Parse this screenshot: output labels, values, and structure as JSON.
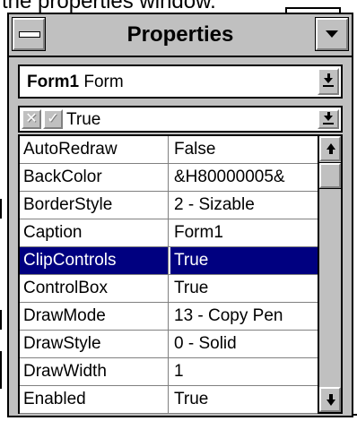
{
  "caption_text": "the properties window.",
  "window": {
    "title": "Properties",
    "sysmenu_icon": "system-menu-icon",
    "min_icon": "minimize-arrow-icon"
  },
  "object_combo": {
    "name": "Form1",
    "type": "Form"
  },
  "edit_bar": {
    "cancel_glyph": "✕",
    "accept_glyph": "✓",
    "value": "True"
  },
  "properties": [
    {
      "name": "AutoRedraw",
      "value": "False",
      "selected": false
    },
    {
      "name": "BackColor",
      "value": "&H80000005&",
      "selected": false
    },
    {
      "name": "BorderStyle",
      "value": "2 - Sizable",
      "selected": false
    },
    {
      "name": "Caption",
      "value": "Form1",
      "selected": false
    },
    {
      "name": "ClipControls",
      "value": "True",
      "selected": true
    },
    {
      "name": "ControlBox",
      "value": "True",
      "selected": false
    },
    {
      "name": "DrawMode",
      "value": "13 - Copy Pen",
      "selected": false
    },
    {
      "name": "DrawStyle",
      "value": "0 - Solid",
      "selected": false
    },
    {
      "name": "DrawWidth",
      "value": "1",
      "selected": false
    },
    {
      "name": "Enabled",
      "value": "True",
      "selected": false
    }
  ],
  "colors": {
    "selection": "#000080",
    "face": "#c0c0c0"
  }
}
